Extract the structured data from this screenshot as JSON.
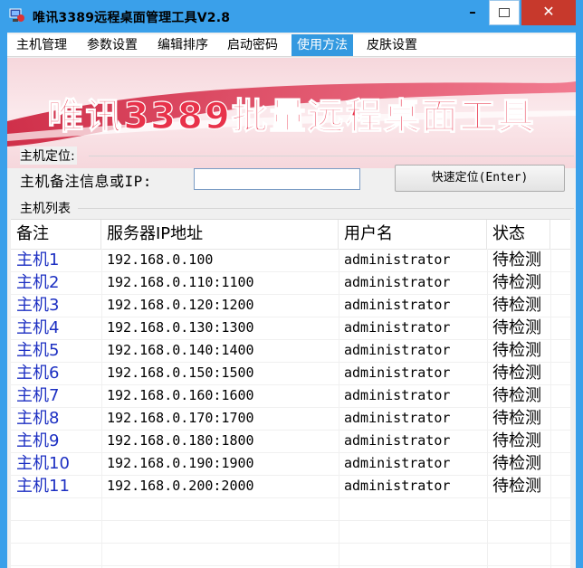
{
  "window": {
    "title": "唯讯3389远程桌面管理工具V2.8",
    "minimize_glyph": "–",
    "close_glyph": "✕"
  },
  "menu": {
    "items": [
      {
        "label": "主机管理"
      },
      {
        "label": "参数设置"
      },
      {
        "label": "编辑排序"
      },
      {
        "label": "启动密码"
      },
      {
        "label": "使用方法",
        "active": true
      },
      {
        "label": "皮肤设置"
      }
    ]
  },
  "banner": {
    "text": "唯讯3389批量远程桌面工具"
  },
  "locate_group": {
    "title": "主机定位:",
    "label": "主机备注信息或IP:",
    "input_value": "",
    "button_label": "快速定位(Enter)"
  },
  "list_group": {
    "title": "主机列表",
    "columns": [
      "备注",
      "服务器IP地址",
      "用户名",
      "状态"
    ],
    "rows": [
      {
        "note": "主机1",
        "ip": "192.168.0.100",
        "user": "administrator",
        "status": "待检测"
      },
      {
        "note": "主机2",
        "ip": "192.168.0.110:1100",
        "user": "administrator",
        "status": "待检测"
      },
      {
        "note": "主机3",
        "ip": "192.168.0.120:1200",
        "user": "administrator",
        "status": "待检测"
      },
      {
        "note": "主机4",
        "ip": "192.168.0.130:1300",
        "user": "administrator",
        "status": "待检测"
      },
      {
        "note": "主机5",
        "ip": "192.168.0.140:1400",
        "user": "administrator",
        "status": "待检测"
      },
      {
        "note": "主机6",
        "ip": "192.168.0.150:1500",
        "user": "administrator",
        "status": "待检测"
      },
      {
        "note": "主机7",
        "ip": "192.168.0.160:1600",
        "user": "administrator",
        "status": "待检测"
      },
      {
        "note": "主机8",
        "ip": "192.168.0.170:1700",
        "user": "administrator",
        "status": "待检测"
      },
      {
        "note": "主机9",
        "ip": "192.168.0.180:1800",
        "user": "administrator",
        "status": "待检测"
      },
      {
        "note": "主机10",
        "ip": "192.168.0.190:1900",
        "user": "administrator",
        "status": "待检测"
      },
      {
        "note": "主机11",
        "ip": "192.168.0.200:2000",
        "user": "administrator",
        "status": "待检测"
      }
    ]
  },
  "colors": {
    "title_bar": "#3aa0ea",
    "close_button": "#c7392c",
    "active_menu": "#3399e0",
    "host_name_text": "#1c2fc2",
    "banner_text": "#e8324a",
    "banner_bg": "#f6d7dc"
  }
}
